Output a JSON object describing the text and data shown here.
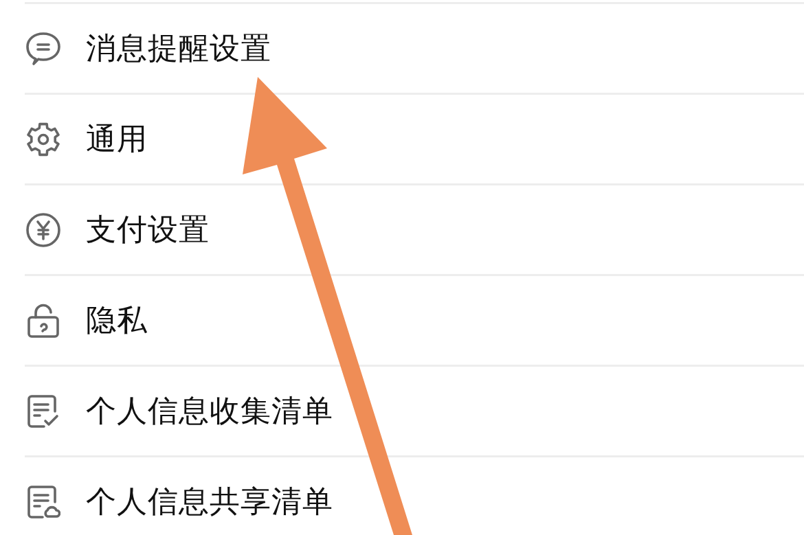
{
  "settings_list": {
    "items": [
      {
        "label": "消息提醒设置"
      },
      {
        "label": "通用"
      },
      {
        "label": "支付设置"
      },
      {
        "label": "隐私"
      },
      {
        "label": "个人信息收集清单"
      },
      {
        "label": "个人信息共享清单"
      }
    ]
  }
}
